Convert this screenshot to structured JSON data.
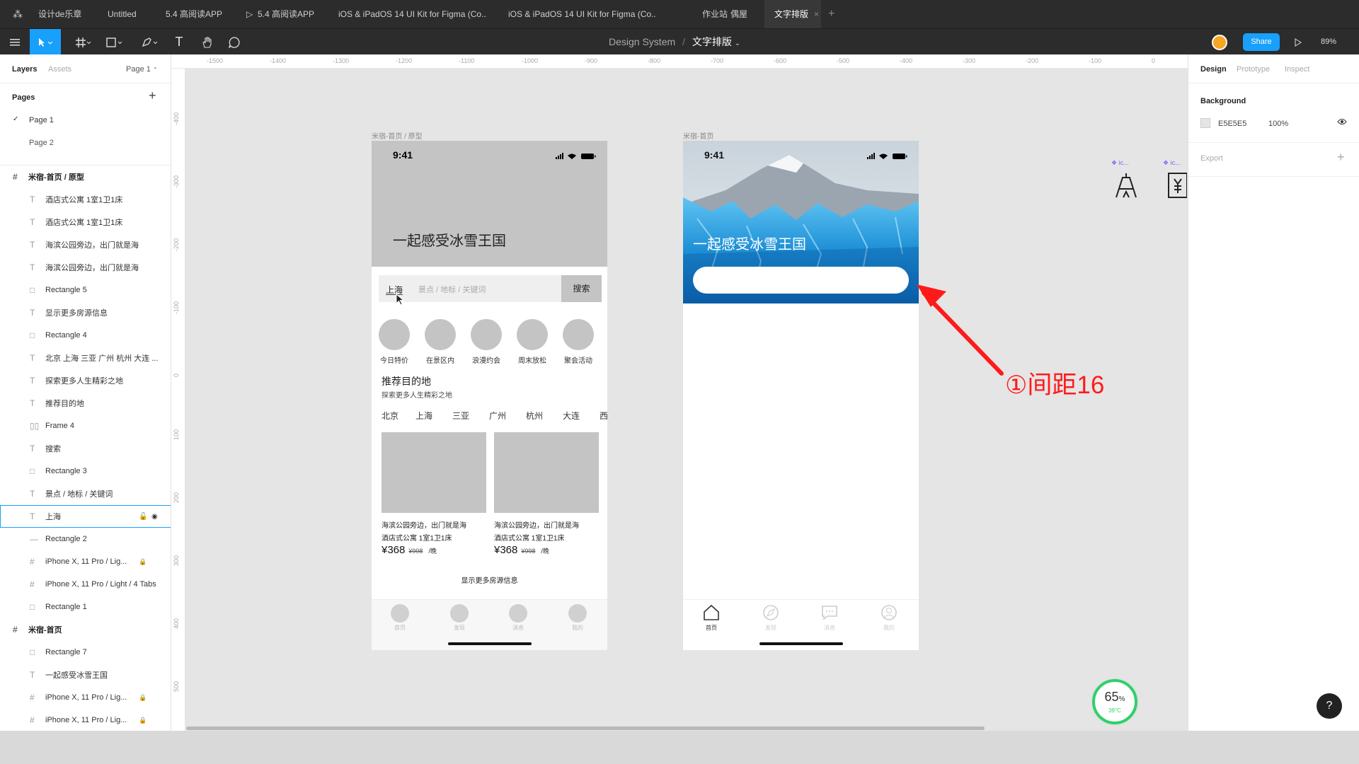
{
  "tabs": [
    "设计de乐章",
    "Untitled",
    "5.4 高阅读APP",
    "5.4 高阅读APP",
    "iOS & iPadOS 14 UI Kit for Figma (Co...",
    "iOS & iPadOS 14 UI Kit for Figma (Co...",
    "作业站",
    "偶屋",
    "文字排版"
  ],
  "toolbar": {
    "breadcrumb_file": "Design System",
    "breadcrumb_sep": "/",
    "breadcrumb_page": "文字排版",
    "share": "Share",
    "zoom": "89%"
  },
  "left": {
    "tab_layers": "Layers",
    "tab_assets": "Assets",
    "page_select": "Page 1",
    "pages_title": "Pages",
    "pages": [
      "Page 1",
      "Page 2"
    ],
    "layers": [
      {
        "name": "米宿-首页 / 原型",
        "kind": "frame",
        "icon": "#"
      },
      {
        "name": "酒店式公寓 1室1卫1床",
        "kind": "text",
        "icon": "T"
      },
      {
        "name": "酒店式公寓 1室1卫1床",
        "kind": "text",
        "icon": "T"
      },
      {
        "name": "海滨公园旁边，出门就是海",
        "kind": "text",
        "icon": "T"
      },
      {
        "name": "海滨公园旁边，出门就是海",
        "kind": "text",
        "icon": "T"
      },
      {
        "name": "Rectangle 5",
        "kind": "rect",
        "icon": "□"
      },
      {
        "name": "显示更多房源信息",
        "kind": "text",
        "icon": "T"
      },
      {
        "name": "Rectangle 4",
        "kind": "rect",
        "icon": "□"
      },
      {
        "name": "北京 上海 三亚 广州 杭州 大连 ...",
        "kind": "text",
        "icon": "T"
      },
      {
        "name": "探索更多人生精彩之地",
        "kind": "text",
        "icon": "T"
      },
      {
        "name": "推荐目的地",
        "kind": "text",
        "icon": "T"
      },
      {
        "name": "Frame 4",
        "kind": "frame4",
        "icon": "▯▯"
      },
      {
        "name": "搜索",
        "kind": "text",
        "icon": "T"
      },
      {
        "name": "Rectangle 3",
        "kind": "rect",
        "icon": "□"
      },
      {
        "name": "景点 / 地标 / 关键词",
        "kind": "text",
        "icon": "T"
      },
      {
        "name": "上海",
        "kind": "text",
        "icon": "T",
        "selected": true
      },
      {
        "name": "Rectangle 2",
        "kind": "line",
        "icon": "—"
      },
      {
        "name": "iPhone X, 11 Pro / Lig...",
        "kind": "instance",
        "icon": "#",
        "locked": true
      },
      {
        "name": "iPhone X, 11 Pro / Light / 4 Tabs",
        "kind": "instance",
        "icon": "#"
      },
      {
        "name": "Rectangle 1",
        "kind": "rect",
        "icon": "□"
      },
      {
        "name": "米宿-首页",
        "kind": "frame",
        "icon": "#"
      },
      {
        "name": "Rectangle 7",
        "kind": "rect",
        "icon": "□"
      },
      {
        "name": "一起感受冰雪王国",
        "kind": "text",
        "icon": "T"
      },
      {
        "name": "iPhone X, 11 Pro / Lig...",
        "kind": "instance",
        "icon": "#",
        "locked": true
      },
      {
        "name": "iPhone X, 11 Pro / Lig...",
        "kind": "instance",
        "icon": "#",
        "locked": true
      }
    ]
  },
  "right": {
    "tabs": [
      "Design",
      "Prototype",
      "Inspect"
    ],
    "bg_title": "Background",
    "bg_hex": "E5E5E5",
    "bg_opacity": "100%",
    "export_title": "Export"
  },
  "rulers": {
    "top": [
      "-1500",
      "-1400",
      "-1300",
      "-1200",
      "-1100",
      "-1000",
      "-900",
      "-800",
      "-700",
      "-600",
      "-500",
      "-400",
      "-300",
      "-200",
      "-100",
      "0"
    ],
    "left": [
      "-400",
      "-300",
      "-200",
      "-100",
      "0",
      "100",
      "200",
      "300",
      "400",
      "500"
    ]
  },
  "frame1": {
    "label": "米宿-首页 / 原型",
    "time": "9:41",
    "hero_title": "一起感受冰雪王国",
    "search_city": "上海",
    "search_placeholder": "景点 / 地标 / 关键词",
    "search_btn": "搜索",
    "categories": [
      "今日特价",
      "在景区内",
      "浪漫约会",
      "周末放松",
      "聚会活动"
    ],
    "section_title": "推荐目的地",
    "section_sub": "探索更多人生精彩之地",
    "cities": [
      "北京",
      "上海",
      "三亚",
      "广州",
      "杭州",
      "大连",
      "西"
    ],
    "cards": [
      {
        "l1": "海滨公园旁边，出门就是海",
        "l2": "酒店式公寓 1室1卫1床",
        "price": "¥368",
        "old": "¥998",
        "unit": "/晚"
      },
      {
        "l1": "海滨公园旁边，出门就是海",
        "l2": "酒店式公寓 1室1卫1床",
        "price": "¥368",
        "old": "¥998",
        "unit": "/晚"
      }
    ],
    "more": "显示更多房源信息",
    "nav": [
      "首页",
      "发现",
      "消息",
      "我的"
    ]
  },
  "frame2": {
    "label": "米宿-首页",
    "time": "9:41",
    "hero_title": "一起感受冰雪王国",
    "nav": [
      "首页",
      "发现",
      "消息",
      "我的"
    ]
  },
  "annotation": {
    "text": "①间距16",
    "color": "#ff1a1a"
  },
  "floating_icons": [
    {
      "label": "ic..."
    },
    {
      "label": "ic..."
    }
  ],
  "badge": {
    "percent": "65",
    "unit": "%",
    "temp": "39°C"
  },
  "help": "?",
  "colors": {
    "accent": "#18a0fb",
    "dark_ui": "#2c2c2c",
    "canvas": "#e5e5e5",
    "placeholder": "#c4c4c4"
  }
}
